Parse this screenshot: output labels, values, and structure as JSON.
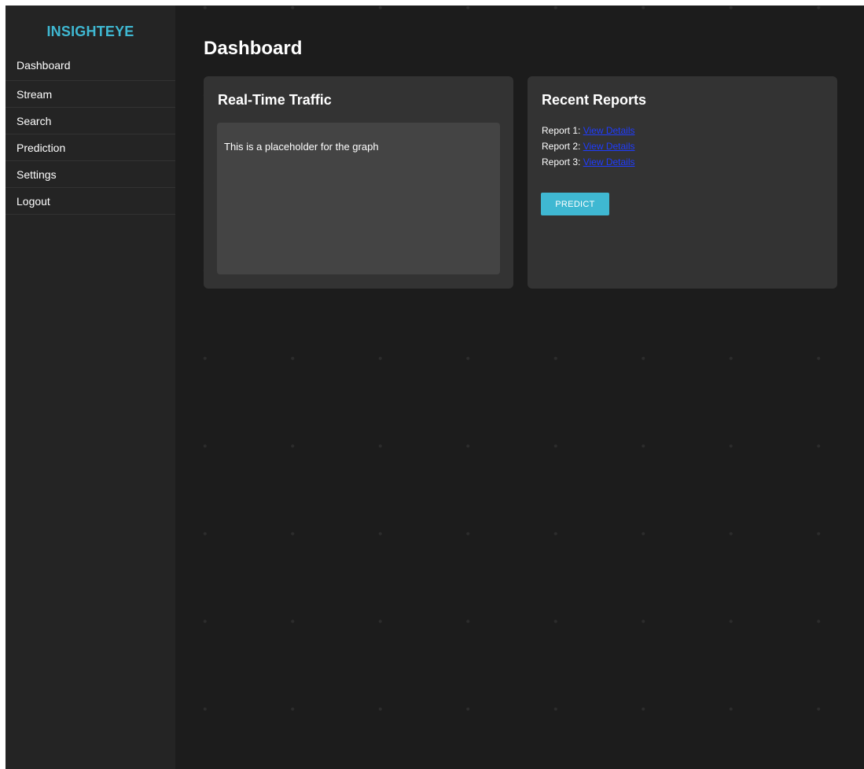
{
  "app": {
    "brand": "INSIGHTEYE",
    "accent_color": "#3fb8d2",
    "background_color": "#1c1c1c",
    "sidebar_color": "#242424",
    "card_color": "#333333"
  },
  "sidebar": {
    "items": [
      {
        "label": "Dashboard"
      },
      {
        "label": "Stream"
      },
      {
        "label": "Search"
      },
      {
        "label": "Prediction"
      },
      {
        "label": "Settings"
      },
      {
        "label": "Logout"
      }
    ]
  },
  "main": {
    "title": "Dashboard",
    "traffic_card": {
      "title": "Real-Time Traffic",
      "placeholder": "This is a placeholder for the graph"
    },
    "reports_card": {
      "title": "Recent Reports",
      "reports": [
        {
          "label": "Report 1:",
          "link": "View Details"
        },
        {
          "label": "Report 2:",
          "link": "View Details"
        },
        {
          "label": "Report 3:",
          "link": "View Details"
        }
      ],
      "predict_button": "PREDICT"
    }
  }
}
